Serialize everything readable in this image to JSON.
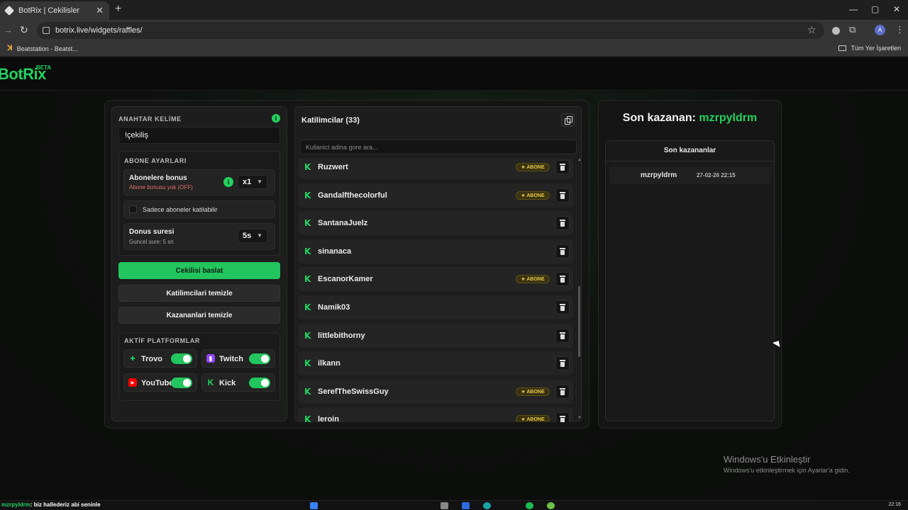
{
  "browser": {
    "tab_title": "BotRix | Cekilisler",
    "tab_close": "✕",
    "new_tab": "+",
    "url": "botrix.live/widgets/raffles/",
    "bookmark": "Beatstation - Beatst...",
    "all_bookmarks": "Tüm Yer İşaretleri",
    "avatar_letter": "A",
    "window_controls": [
      "—",
      "▢",
      "✕"
    ]
  },
  "logo": {
    "text": "BotRix",
    "badge": "BETA"
  },
  "left": {
    "keyword_label": "ANAHTAR KELİME",
    "keyword_value": "!çekiliş",
    "info_mark": "i",
    "sub_settings_label": "ABONE AYARLARI",
    "subscriber_bonus": {
      "title": "Abonelere bonus",
      "subtitle": "Abone bonusu yok (OFF)",
      "value": "x1"
    },
    "subs_only_label": "Sadece aboneler katilabilir",
    "bonus_time": {
      "title": "Donus suresi",
      "subtitle": "Guncel sure: 5 sn",
      "value": "5s"
    },
    "start_button": "Cekilisi baslat",
    "clear_participants": "Katilimcilari temizle",
    "clear_winners": "Kazananlari temizle",
    "platforms_label": "AKTİF PLATFORMLAR",
    "platforms": [
      {
        "name": "Trovo",
        "icon": "trovo-icon",
        "enabled": true
      },
      {
        "name": "Twitch",
        "icon": "twitch-icon",
        "enabled": true
      },
      {
        "name": "YouTube",
        "icon": "youtube-icon",
        "enabled": true
      },
      {
        "name": "Kick",
        "icon": "kick-icon",
        "enabled": true
      }
    ]
  },
  "participants": {
    "title": "Katilimcilar (33)",
    "search_placeholder": "Kullanici adina gore ara...",
    "badge_label": "★ ABONE",
    "items": [
      {
        "name": "Ruzwert",
        "subscriber": true
      },
      {
        "name": "Gandalfthecolorful",
        "subscriber": true
      },
      {
        "name": "SantanaJuelz",
        "subscriber": false
      },
      {
        "name": "sinanaca",
        "subscriber": false
      },
      {
        "name": "EscanorKamer",
        "subscriber": true
      },
      {
        "name": "Namik03",
        "subscriber": false
      },
      {
        "name": "littlebithorny",
        "subscriber": false
      },
      {
        "name": "ilkann",
        "subscriber": false
      },
      {
        "name": "SerefTheSwissGuy",
        "subscriber": true
      },
      {
        "name": "leroin",
        "subscriber": true
      }
    ]
  },
  "winners": {
    "last_winner_label": "Son kazanan:",
    "last_winner_name": "mzrpyldrm",
    "list_title": "Son kazananlar",
    "items": [
      {
        "name": "mzrpyldrm",
        "date": "27-02-26 22:15"
      }
    ]
  },
  "activation": {
    "title": "Windows'u Etkinleştir",
    "subtitle": "Windows'u etkinleştirmek için Ayarlar'a gidin."
  },
  "chat": {
    "user": "mzrpyldrm",
    "message": ": biz hallederiz abi seninle"
  },
  "clock": "22:16",
  "colors": {
    "accent": "#23d160",
    "badge": "#e9c84a",
    "background": "#0d0e0d"
  }
}
